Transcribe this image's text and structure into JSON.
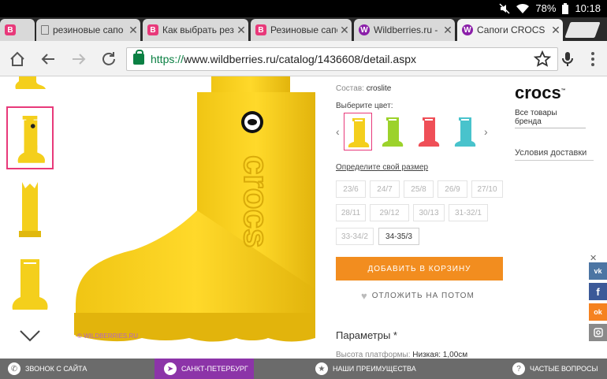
{
  "status_bar": {
    "battery": "78%",
    "time": "10:18"
  },
  "tabs": [
    {
      "title": "",
      "favicon": "pink"
    },
    {
      "title": "резиновые сапо",
      "favicon": "doc"
    },
    {
      "title": "Как выбрать рез",
      "favicon": "pink"
    },
    {
      "title": "Резиновые сапо",
      "favicon": "pink"
    },
    {
      "title": "Wildberries.ru - Ч",
      "favicon": "wb"
    },
    {
      "title": "Сапоги CROCS",
      "favicon": "wb"
    }
  ],
  "toolbar": {
    "url_scheme": "https://",
    "url_rest": "www.wildberries.ru/catalog/1436608/detail.aspx"
  },
  "product": {
    "composition_label": "Состав:",
    "composition_value": "croslite",
    "color_label": "Выберите цвет:",
    "colors": [
      "#f4cf1c",
      "#9cd22b",
      "#ef4f57",
      "#49c3cc"
    ],
    "size_label": "Определите свой размер",
    "sizes": [
      {
        "label": "23/6",
        "available": false
      },
      {
        "label": "24/7",
        "available": false
      },
      {
        "label": "25/8",
        "available": false
      },
      {
        "label": "26/9",
        "available": false
      },
      {
        "label": "27/10",
        "available": false
      },
      {
        "label": "28/11",
        "available": false
      },
      {
        "label": "29/12",
        "available": false
      },
      {
        "label": "30/13",
        "available": false
      },
      {
        "label": "31-32/1",
        "available": false
      },
      {
        "label": "33-34/2",
        "available": false
      },
      {
        "label": "34-35/3",
        "available": true
      }
    ],
    "cart_button": "ДОБАВИТЬ В КОРЗИНУ",
    "later_button": "ОТЛОЖИТЬ НА ПОТОМ",
    "params_title": "Параметры *",
    "platform_label": "Высота платформы:",
    "platform_value": "Низкая: 1,00см",
    "watermark": "© WILDBERRIES.RU",
    "boot_logo_text": "crocs"
  },
  "brand": {
    "logo": "crocs",
    "all_goods_link": "Все товары бренда",
    "delivery": "Условия доставки"
  },
  "social": [
    {
      "label": "vk",
      "color": "#4c75a3"
    },
    {
      "label": "f",
      "color": "#3b5998"
    },
    {
      "label": "ok",
      "color": "#f58220"
    },
    {
      "label": "ig",
      "color": "#8a8a8a"
    }
  ],
  "bottom_bar": {
    "callback": "ЗВОНОК С САЙТА",
    "city": "САНКТ-ПЕТЕРБУРГ",
    "benefits": "НАШИ ПРЕИМУЩЕСТВА",
    "faq": "ЧАСТЫЕ ВОПРОСЫ"
  },
  "colors": {
    "accent_orange": "#f28d1f",
    "brand_pink": "#e8397a",
    "city_purple": "#8c34a8"
  }
}
